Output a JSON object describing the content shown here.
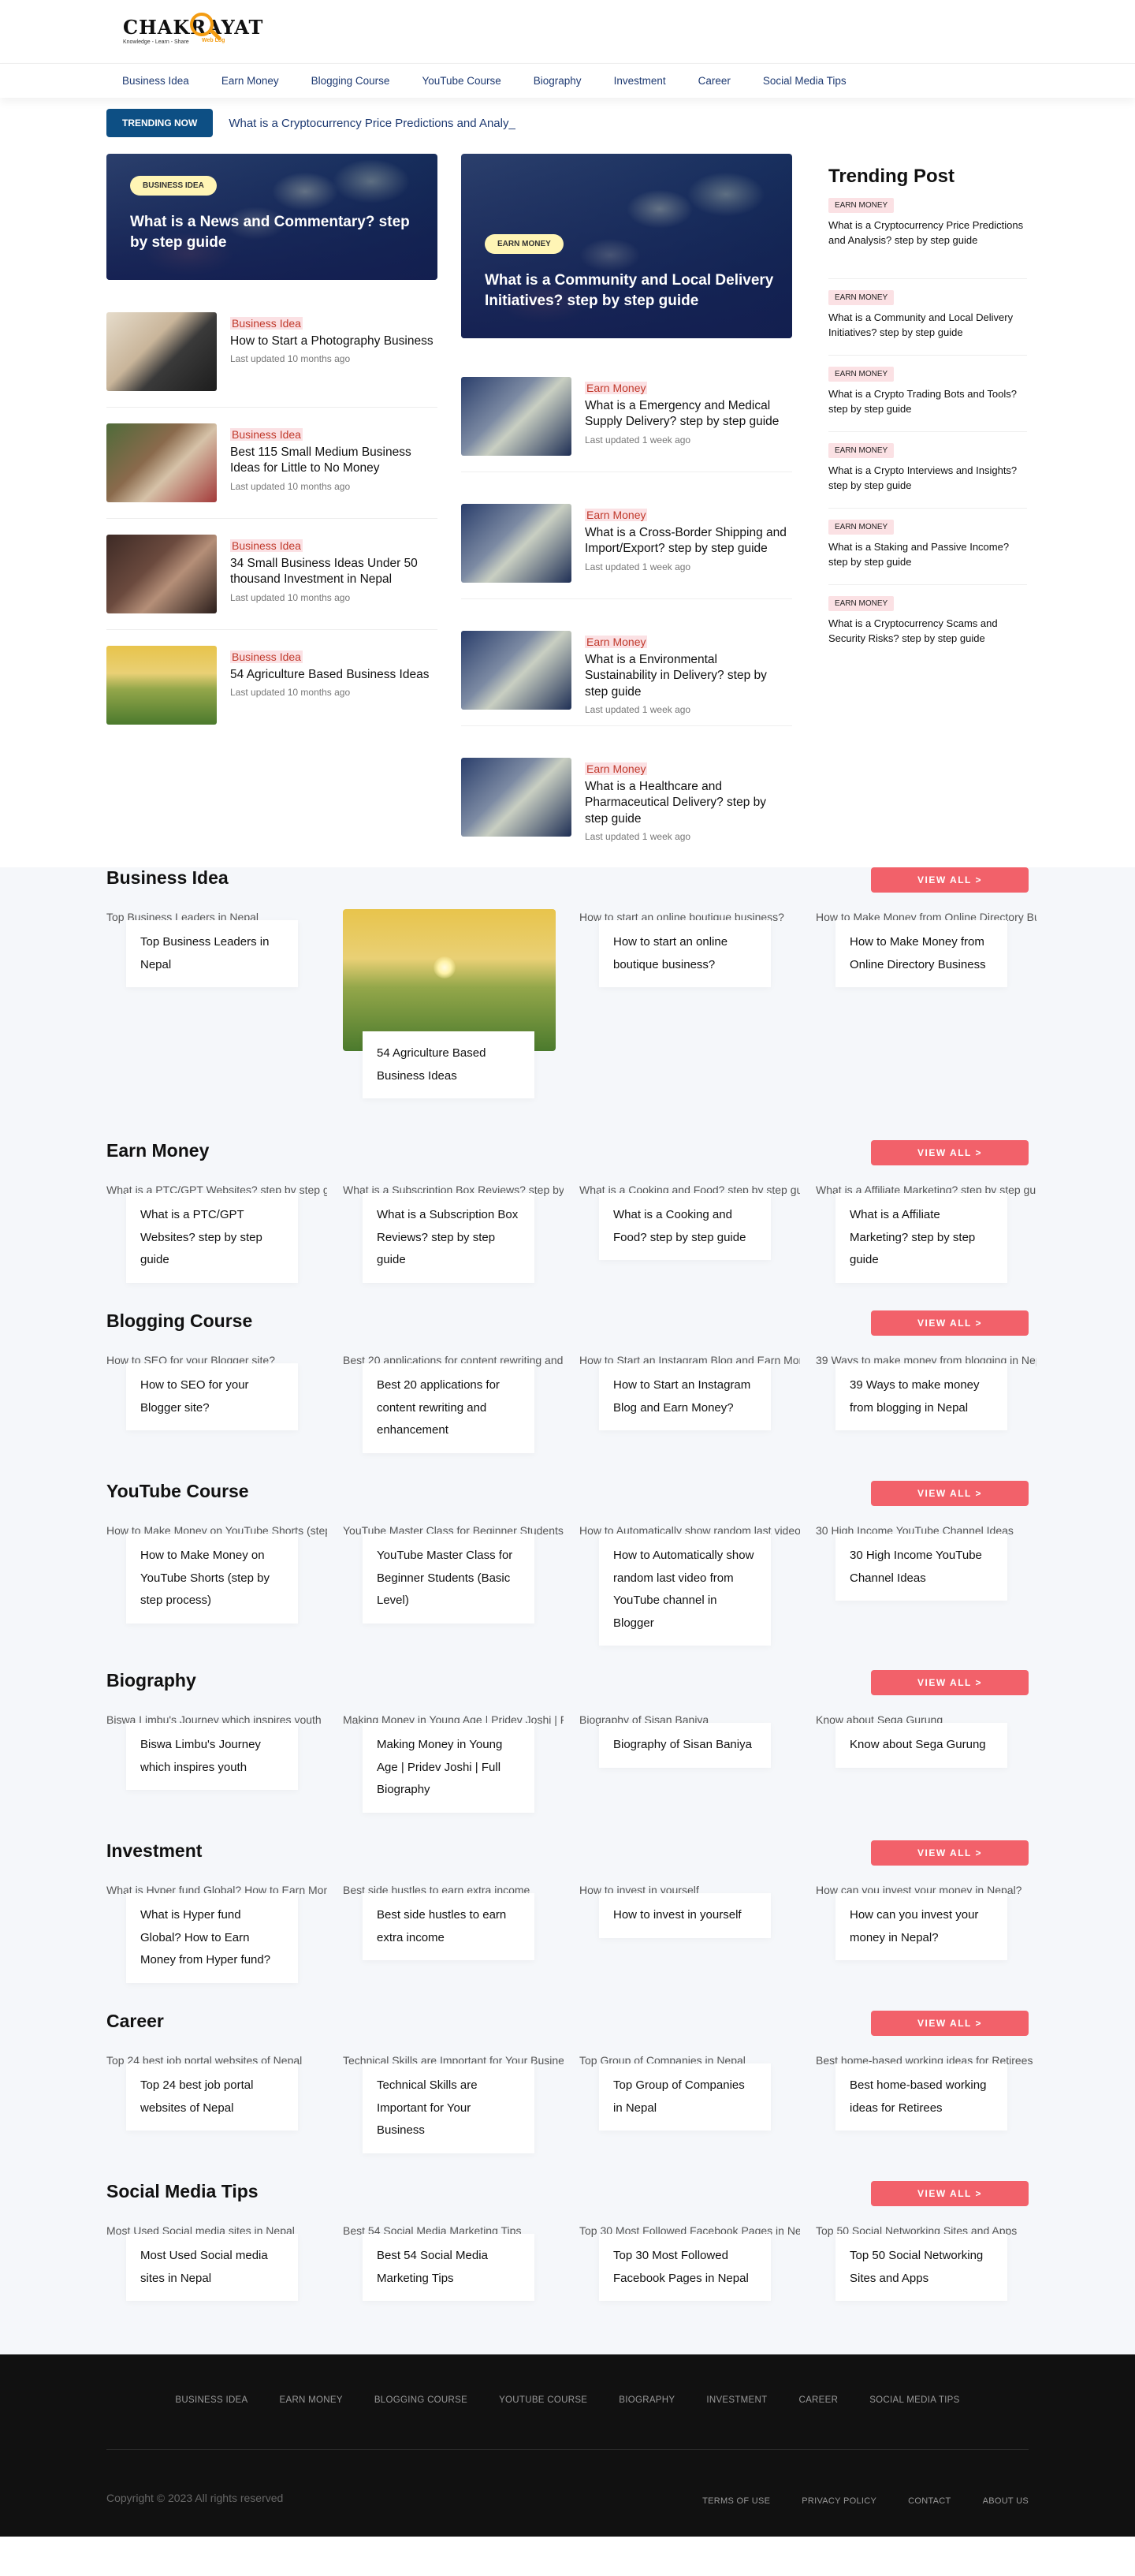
{
  "logo": {
    "text": "CHAKRAYAT",
    "tagline": "Knowledge - Learn - Share",
    "tag": "Web Log"
  },
  "nav": [
    "Business Idea",
    "Earn Money",
    "Blogging Course",
    "YouTube Course",
    "Biography",
    "Investment",
    "Career",
    "Social Media Tips"
  ],
  "trending": {
    "badge": "TRENDING NOW",
    "headline": "What is a Cryptocurrency Price Predictions and Analy_"
  },
  "features": [
    {
      "category": "BUSINESS IDEA",
      "title": "What is a News and Commentary? step by step guide"
    },
    {
      "category": "EARN MONEY",
      "title": "What is a Community and Local Delivery Initiatives? step by step guide"
    }
  ],
  "left_list": [
    {
      "category": "Business Idea",
      "title": "How to Start a Photography Business",
      "meta": "Last updated 10 months ago"
    },
    {
      "category": "Business Idea",
      "title": "Best 115 Small Medium Business Ideas for Little to No Money",
      "meta": "Last updated 10 months ago"
    },
    {
      "category": "Business Idea",
      "title": "34 Small Business Ideas Under 50 thousand Investment in Nepal",
      "meta": "Last updated 10 months ago"
    },
    {
      "category": "Business Idea",
      "title": "54 Agriculture Based Business Ideas",
      "meta": "Last updated 10 months ago"
    }
  ],
  "mid_list": [
    {
      "category": "Earn Money",
      "title": "What is a Emergency and Medical Supply Delivery? step by step guide",
      "meta": "Last updated 1 week ago"
    },
    {
      "category": "Earn Money",
      "title": "What is a Cross-Border Shipping and Import/Export? step by step guide",
      "meta": "Last updated 1 week ago"
    },
    {
      "category": "Earn Money",
      "title": "What is a Environmental Sustainability in Delivery? step by step guide",
      "meta": "Last updated 1 week ago"
    },
    {
      "category": "Earn Money",
      "title": "What is a Healthcare and Pharmaceutical Delivery? step by step guide",
      "meta": "Last updated 1 week ago"
    }
  ],
  "trending_post": {
    "title": "Trending Post",
    "items": [
      {
        "badge": "EARN MONEY",
        "title": "What is a Cryptocurrency Price Predictions and Analysis? step by step guide"
      },
      {
        "badge": "EARN MONEY",
        "title": "What is a Community and Local Delivery Initiatives? step by step guide"
      },
      {
        "badge": "EARN MONEY",
        "title": "What is a Crypto Trading Bots and Tools? step by step guide"
      },
      {
        "badge": "EARN MONEY",
        "title": "What is a Crypto Interviews and Insights? step by step guide"
      },
      {
        "badge": "EARN MONEY",
        "title": "What is a Staking and Passive Income? step by step guide"
      },
      {
        "badge": "EARN MONEY",
        "title": "What is a Cryptocurrency Scams and Security Risks? step by step guide"
      }
    ]
  },
  "view_all": "VIEW ALL >",
  "sections": [
    {
      "title": "Business Idea",
      "cards": [
        {
          "alt": "Top Business Leaders in Nepal",
          "title": "Top Business Leaders in Nepal"
        },
        {
          "alt": "",
          "title": "54 Agriculture Based Business Ideas",
          "image": true
        },
        {
          "alt": "How to start an online boutique business?",
          "title": "How to start an online boutique business?"
        },
        {
          "alt": "How to Make Money from Online Directory Business",
          "title": "How to Make Money from Online Directory Business"
        }
      ]
    },
    {
      "title": "Earn Money",
      "cards": [
        {
          "alt": "What is a PTC/GPT Websites? step by step guide",
          "title": "What is a PTC/GPT Websites? step by step guide"
        },
        {
          "alt": "What is a Subscription Box Reviews? step by step guide",
          "title": "What is a Subscription Box Reviews? step by step guide"
        },
        {
          "alt": "What is a Cooking and Food? step by step guide",
          "title": "What is a Cooking and Food? step by step guide"
        },
        {
          "alt": "What is a Affiliate Marketing? step by step guide",
          "title": "What is a Affiliate Marketing? step by step guide"
        }
      ]
    },
    {
      "title": "Blogging Course",
      "cards": [
        {
          "alt": "How to SEO for your Blogger site?",
          "title": "How to SEO for your Blogger site?"
        },
        {
          "alt": "Best 20 applications for content rewriting and enhancement",
          "title": "Best 20 applications for content rewriting and enhancement"
        },
        {
          "alt": "How to Start an Instagram Blog and Earn Money?",
          "title": "How to Start an Instagram Blog and Earn Money?"
        },
        {
          "alt": "39 Ways to make money from blogging in Nepal",
          "title": "39 Ways to make money from blogging in Nepal"
        }
      ]
    },
    {
      "title": "YouTube Course",
      "cards": [
        {
          "alt": "How to Make Money on YouTube Shorts (step by step process)",
          "title": "How to Make Money on YouTube Shorts (step by step process)"
        },
        {
          "alt": "YouTube Master Class for Beginner Students (Basic Level)",
          "title": "YouTube Master Class for Beginner Students (Basic Level)"
        },
        {
          "alt": "How to Automatically show random last video from YouTube channel in Blogger",
          "title": "How to Automatically show random last video from YouTube channel in Blogger"
        },
        {
          "alt": "30 High Income YouTube Channel Ideas",
          "title": "30 High Income YouTube Channel Ideas"
        }
      ]
    },
    {
      "title": "Biography",
      "cards": [
        {
          "alt": "Biswa Limbu's Journey which inspires youth",
          "title": "Biswa Limbu's Journey which inspires youth"
        },
        {
          "alt": "Making Money in Young Age | Pridev Joshi | Full Biography",
          "title": "Making Money in Young Age | Pridev Joshi | Full Biography"
        },
        {
          "alt": "Biography of Sisan Baniya",
          "title": "Biography of Sisan Baniya"
        },
        {
          "alt": "Know about Sega Gurung",
          "title": "Know about Sega Gurung"
        }
      ]
    },
    {
      "title": "Investment",
      "cards": [
        {
          "alt": "What is Hyper fund Global? How to Earn Money from Hyper fund?",
          "title": "What is Hyper fund Global? How to Earn Money from Hyper fund?"
        },
        {
          "alt": "Best side hustles to earn extra income",
          "title": "Best side hustles to earn extra income"
        },
        {
          "alt": "How to invest in yourself",
          "title": "How to invest in yourself"
        },
        {
          "alt": "How can you invest your money in Nepal?",
          "title": "How can you invest your money in Nepal?"
        }
      ]
    },
    {
      "title": "Career",
      "cards": [
        {
          "alt": "Top 24 best job portal websites of Nepal",
          "title": "Top 24 best job portal websites of Nepal"
        },
        {
          "alt": "Technical Skills are Important for Your Business",
          "title": "Technical Skills are Important for Your Business"
        },
        {
          "alt": "Top Group of Companies in Nepal",
          "title": "Top Group of Companies in Nepal"
        },
        {
          "alt": "Best home-based working ideas for Retirees",
          "title": "Best home-based working ideas for Retirees"
        }
      ]
    },
    {
      "title": "Social Media Tips",
      "cards": [
        {
          "alt": "Most Used Social media sites in Nepal",
          "title": "Most Used Social media sites in Nepal"
        },
        {
          "alt": "Best 54 Social Media Marketing Tips",
          "title": "Best 54 Social Media Marketing Tips"
        },
        {
          "alt": "Top 30 Most Followed Facebook Pages in Nepal",
          "title": "Top 30 Most Followed Facebook Pages in Nepal"
        },
        {
          "alt": "Top 50 Social Networking Sites and Apps",
          "title": "Top 50 Social Networking Sites and Apps"
        }
      ]
    }
  ],
  "footer": {
    "nav": [
      "BUSINESS IDEA",
      "EARN MONEY",
      "BLOGGING COURSE",
      "YOUTUBE COURSE",
      "BIOGRAPHY",
      "INVESTMENT",
      "CAREER",
      "SOCIAL MEDIA TIPS"
    ],
    "copyright": "Copyright © 2023 All rights reserved",
    "links": [
      "TERMS OF USE",
      "PRIVACY POLICY",
      "CONTACT",
      "ABOUT US"
    ]
  },
  "colors": {
    "accent": "#f2616a",
    "nav_text": "#1e3a72",
    "trending_badge": "#0d4f84",
    "footer_bg": "#111111"
  }
}
